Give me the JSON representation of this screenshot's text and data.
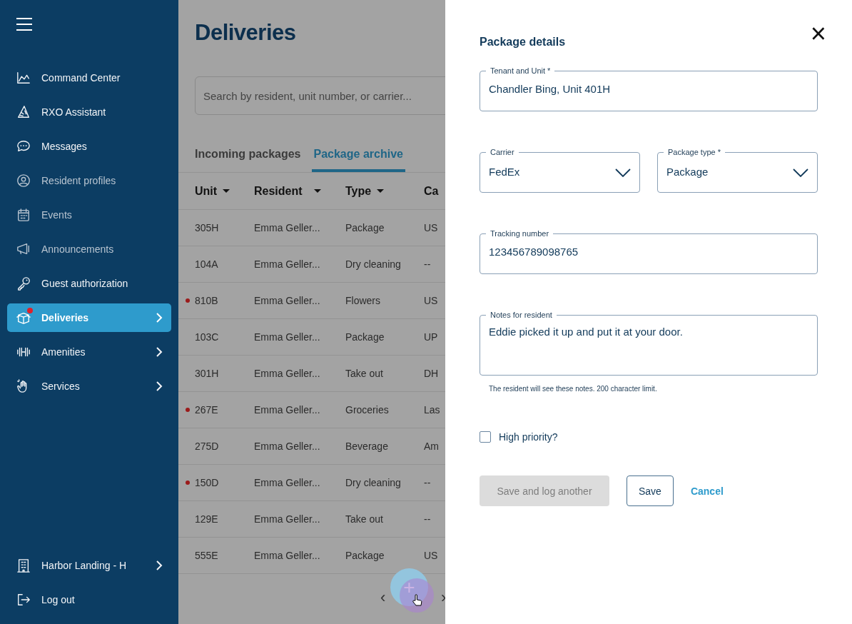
{
  "sidebar": {
    "items": [
      {
        "label": "Command Center",
        "selected": false,
        "dimmed": false,
        "expandable": false,
        "badge": false
      },
      {
        "label": "RXO Assistant",
        "selected": false,
        "dimmed": false,
        "expandable": false,
        "badge": false
      },
      {
        "label": "Messages",
        "selected": false,
        "dimmed": false,
        "expandable": false,
        "badge": false
      },
      {
        "label": "Resident profiles",
        "selected": false,
        "dimmed": true,
        "expandable": false,
        "badge": false
      },
      {
        "label": "Events",
        "selected": false,
        "dimmed": true,
        "expandable": false,
        "badge": false
      },
      {
        "label": "Announcements",
        "selected": false,
        "dimmed": true,
        "expandable": false,
        "badge": false
      },
      {
        "label": "Guest authorization",
        "selected": false,
        "dimmed": false,
        "expandable": false,
        "badge": false
      },
      {
        "label": "Deliveries",
        "selected": true,
        "dimmed": false,
        "expandable": true,
        "badge": true
      },
      {
        "label": "Amenities",
        "selected": false,
        "dimmed": false,
        "expandable": true,
        "badge": false
      },
      {
        "label": "Services",
        "selected": false,
        "dimmed": false,
        "expandable": true,
        "badge": false
      }
    ],
    "footer": [
      {
        "label": "Harbor Landing - H",
        "expandable": true
      },
      {
        "label": "Log out",
        "expandable": false
      }
    ]
  },
  "page": {
    "title": "Deliveries",
    "search": {
      "placeholder": "Search by resident, unit number, or carrier..."
    },
    "tabs": [
      {
        "label": "Incoming packages",
        "selected": false
      },
      {
        "label": "Package archive",
        "selected": true
      }
    ]
  },
  "table": {
    "columns": [
      {
        "label": "Unit",
        "sortable": true
      },
      {
        "label": "Resident",
        "sortable": true
      },
      {
        "label": "Type",
        "sortable": true
      },
      {
        "label": "Ca",
        "sortable": false
      }
    ],
    "rows": [
      {
        "flagged": false,
        "cells": [
          "305H",
          "Emma Geller...",
          "Package",
          "US"
        ]
      },
      {
        "flagged": false,
        "cells": [
          "104A",
          "Emma Geller...",
          "Dry cleaning",
          "--"
        ]
      },
      {
        "flagged": true,
        "cells": [
          "810B",
          "Emma Geller...",
          "Flowers",
          "US"
        ]
      },
      {
        "flagged": false,
        "cells": [
          "103C",
          "Emma Geller...",
          "Package",
          "UP"
        ]
      },
      {
        "flagged": false,
        "cells": [
          "301H",
          "Emma Geller...",
          "Take out",
          "DH"
        ]
      },
      {
        "flagged": true,
        "cells": [
          "267E",
          "Emma Geller...",
          "Groceries",
          "Las"
        ]
      },
      {
        "flagged": false,
        "cells": [
          "275D",
          "Emma Geller...",
          "Beverage",
          "Am"
        ]
      },
      {
        "flagged": true,
        "cells": [
          "150D",
          "Emma Geller...",
          "Dry cleaning",
          "--"
        ]
      },
      {
        "flagged": false,
        "cells": [
          "129E",
          "Emma Geller...",
          "Take out",
          "--"
        ]
      },
      {
        "flagged": false,
        "cells": [
          "555E",
          "Emma Geller...",
          "Package",
          "US"
        ]
      }
    ]
  },
  "pagination": {
    "prev": "‹",
    "next": "›"
  },
  "add_button": {
    "label": "+"
  },
  "drawer": {
    "title": "Package details",
    "close": "×",
    "fields": [
      {
        "kind": "text",
        "label": "Tenant and Unit *",
        "value": "Chandler Bing, Unit 401H"
      },
      {
        "kind": "select",
        "label": "Carrier",
        "value": "FedEx"
      },
      {
        "kind": "select",
        "label": "Package type *",
        "value": "Package"
      },
      {
        "kind": "text",
        "label": "Tracking number",
        "value": "123456789098765"
      },
      {
        "kind": "textarea",
        "label": "Notes for resident",
        "value": "Eddie picked it up and put it at your door.",
        "help": "The resident will see these notes. 200 character limit."
      }
    ],
    "checkbox": {
      "label": "High priority?",
      "checked": false
    },
    "buttons": [
      {
        "kind": "filled",
        "label": "Save and log another",
        "disabled": true
      },
      {
        "kind": "outline",
        "label": "Save",
        "disabled": false
      },
      {
        "kind": "link",
        "label": "Cancel",
        "disabled": false
      }
    ]
  }
}
